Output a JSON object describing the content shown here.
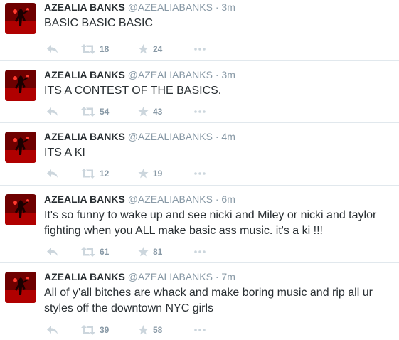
{
  "tweets": [
    {
      "name": "AZEALIA BANKS",
      "handle": "@AZEALIABANKS",
      "separator": "·",
      "time": "3m",
      "text": "BASIC BASIC BASIC",
      "retweets": "18",
      "favorites": "24"
    },
    {
      "name": "AZEALIA BANKS",
      "handle": "@AZEALIABANKS",
      "separator": "·",
      "time": "3m",
      "text": "ITS A CONTEST OF THE BASICS.",
      "retweets": "54",
      "favorites": "43"
    },
    {
      "name": "AZEALIA BANKS",
      "handle": "@AZEALIABANKS",
      "separator": "·",
      "time": "4m",
      "text": "ITS A KI",
      "retweets": "12",
      "favorites": "19"
    },
    {
      "name": "AZEALIA BANKS",
      "handle": "@AZEALIABANKS",
      "separator": "·",
      "time": "6m",
      "text": "It's so funny to wake up and see nicki and Miley or nicki and taylor fighting when you ALL make basic ass music. it's a ki !!!",
      "retweets": "61",
      "favorites": "81"
    },
    {
      "name": "AZEALIA BANKS",
      "handle": "@AZEALIABANKS",
      "separator": "·",
      "time": "7m",
      "text": "All of y'all bitches are whack and make boring music and rip all ur styles off the downtown NYC girls",
      "retweets": "39",
      "favorites": "58"
    }
  ],
  "icons": {
    "reply": "reply-icon",
    "retweet": "retweet-icon",
    "favorite": "star-icon",
    "more": "more-icon"
  },
  "colors": {
    "name": "#292f33",
    "muted": "#8899a6",
    "icon": "#ccd6dd",
    "divider": "#e1e8ed",
    "avatar_bg": "#8b0000"
  }
}
